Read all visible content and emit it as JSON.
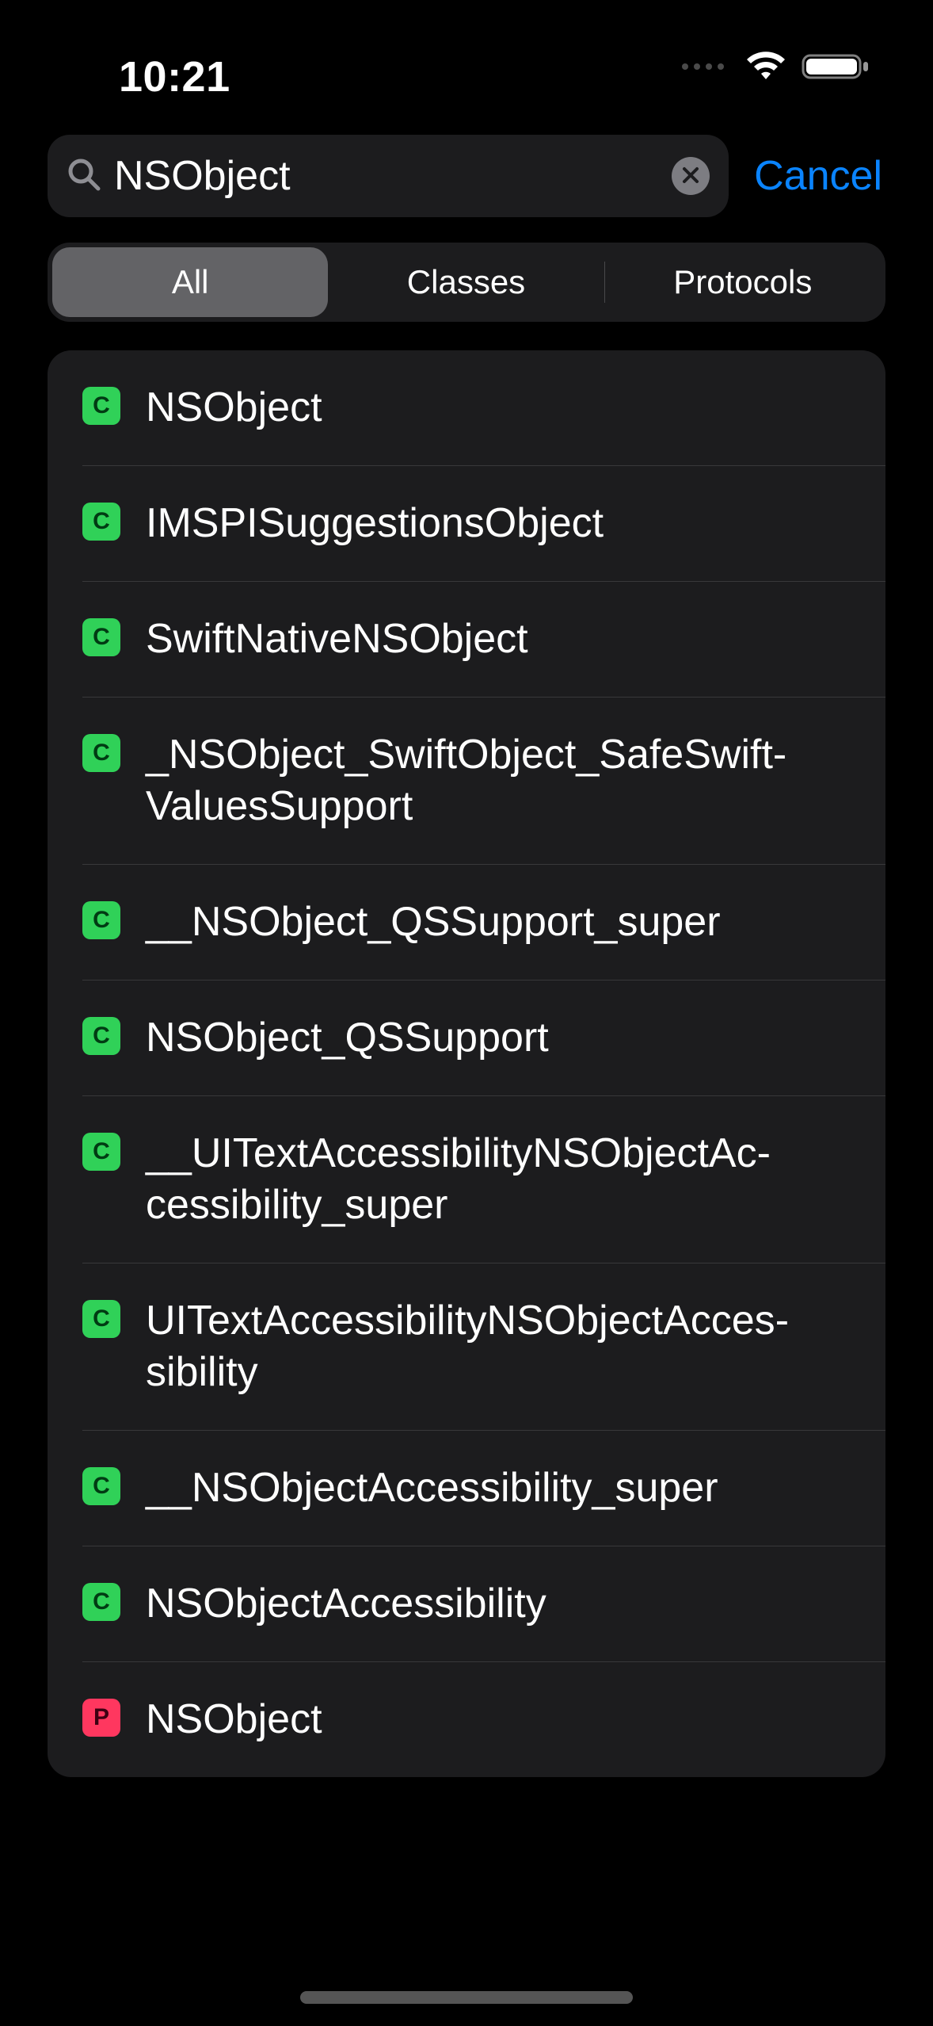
{
  "status": {
    "time": "10:21"
  },
  "search": {
    "value": "NSObject",
    "placeholder": "Search",
    "cancel_label": "Cancel"
  },
  "segments": {
    "items": [
      {
        "label": "All",
        "selected": true
      },
      {
        "label": "Classes",
        "selected": false
      },
      {
        "label": "Protocols",
        "selected": false
      }
    ]
  },
  "results": [
    {
      "type": "C",
      "name": "NSObject"
    },
    {
      "type": "C",
      "name": "IMSPISuggestionsObject"
    },
    {
      "type": "C",
      "name": "SwiftNativeNSObject"
    },
    {
      "type": "C",
      "name": "_NSObject_SwiftObject_SafeSwift­ValuesSupport"
    },
    {
      "type": "C",
      "name": "__NSObject_QSSupport_super"
    },
    {
      "type": "C",
      "name": "NSObject_QSSupport"
    },
    {
      "type": "C",
      "name": "__UITextAccessibilityNSObjectAc­cessibility_super"
    },
    {
      "type": "C",
      "name": "UITextAccessibilityNSObjectAcces­sibility"
    },
    {
      "type": "C",
      "name": "__NSObjectAccessibility_super"
    },
    {
      "type": "C",
      "name": "NSObjectAccessibility"
    },
    {
      "type": "P",
      "name": "NSObject"
    }
  ],
  "colors": {
    "accent_blue": "#0a84ff",
    "class_badge": "#30d158",
    "protocol_badge": "#ff375f",
    "panel_bg": "#1c1c1e",
    "segment_selected": "#636366"
  }
}
